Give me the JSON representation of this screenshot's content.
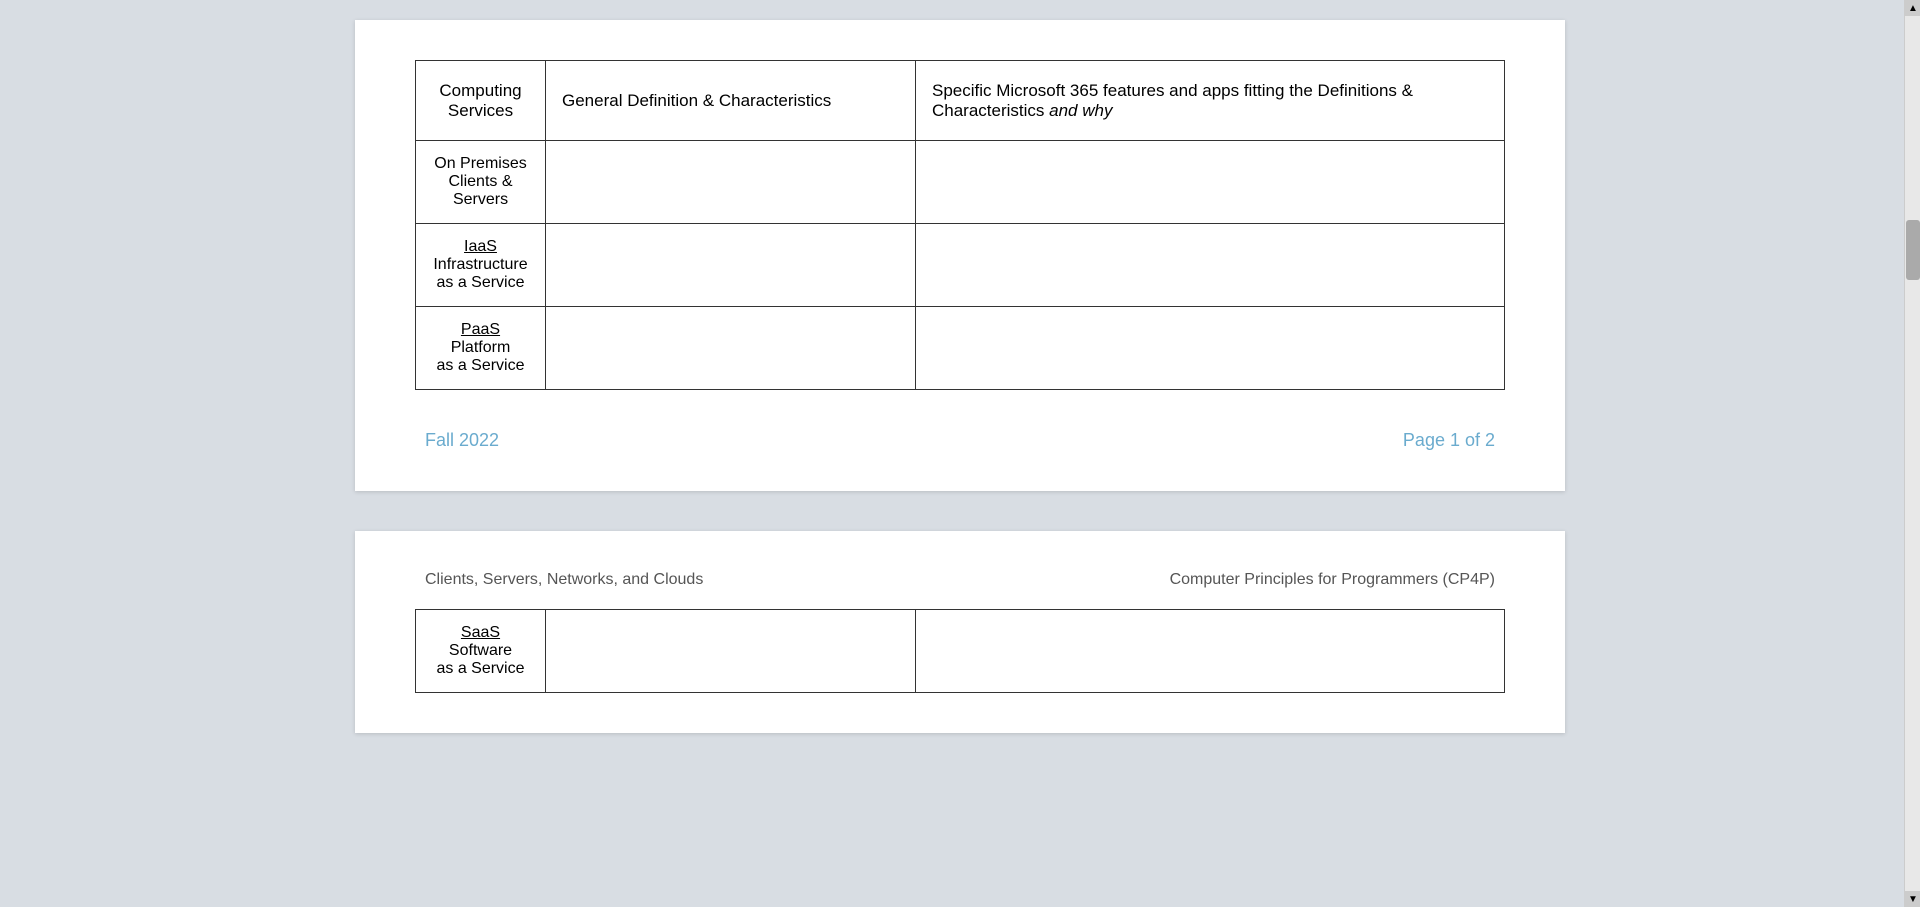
{
  "page1": {
    "table": {
      "headers": {
        "col1": "Computing\nServices",
        "col2": "General Definition & Characteristics",
        "col3_part1": "Specific Microsoft 365 features and apps fitting the Definitions & Characteristics ",
        "col3_italic": "and why",
        "col3_end": ""
      },
      "rows": [
        {
          "service_underline": "",
          "service_text": "On Premises\nClients &\nServers",
          "underline_part": "",
          "col2": "",
          "col3": ""
        },
        {
          "service_underline": "IaaS",
          "service_text": "Infrastructure\nas a Service",
          "col2": "",
          "col3": ""
        },
        {
          "service_underline": "PaaS",
          "service_text": "Platform\nas a Service",
          "col2": "",
          "col3": ""
        }
      ]
    },
    "footer": {
      "left": "Fall 2022",
      "right": "Page 1 of 2"
    }
  },
  "page2": {
    "header": {
      "left": "Clients, Servers, Networks, and Clouds",
      "right": "Computer Principles for Programmers (CP4P)"
    },
    "table": {
      "rows": [
        {
          "service_underline": "SaaS",
          "service_text": "Software\nas a Service",
          "col2": "",
          "col3": ""
        }
      ]
    }
  }
}
